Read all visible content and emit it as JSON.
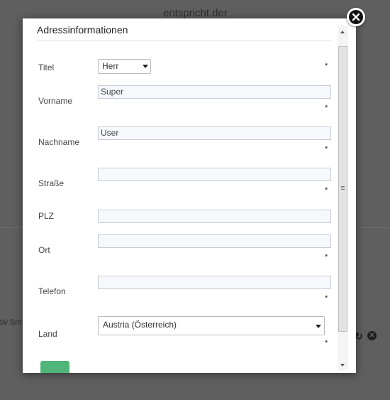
{
  "background": {
    "top_text": "entspricht der",
    "left_text": "tiv Sm"
  },
  "modal": {
    "title": "Adressinformationen",
    "required_marker": "*",
    "fields": {
      "titel": {
        "label": "Titel",
        "selected": "Herr"
      },
      "vorname": {
        "label": "Vorname",
        "value": "Super"
      },
      "nachname": {
        "label": "Nachname",
        "value": "User"
      },
      "strasse": {
        "label": "Straße",
        "value": ""
      },
      "plz": {
        "label": "PLZ",
        "value": ""
      },
      "ort": {
        "label": "Ort",
        "value": ""
      },
      "telefon": {
        "label": "Telefon",
        "value": ""
      },
      "land": {
        "label": "Land",
        "selected": "Austria (Österreich)"
      }
    },
    "submit_color": "#4fb578"
  },
  "icons": {
    "close": "close-icon",
    "dropdown": "chevron-down-icon",
    "scroll_up": "arrow-up-icon",
    "scroll_down": "arrow-down-icon"
  }
}
